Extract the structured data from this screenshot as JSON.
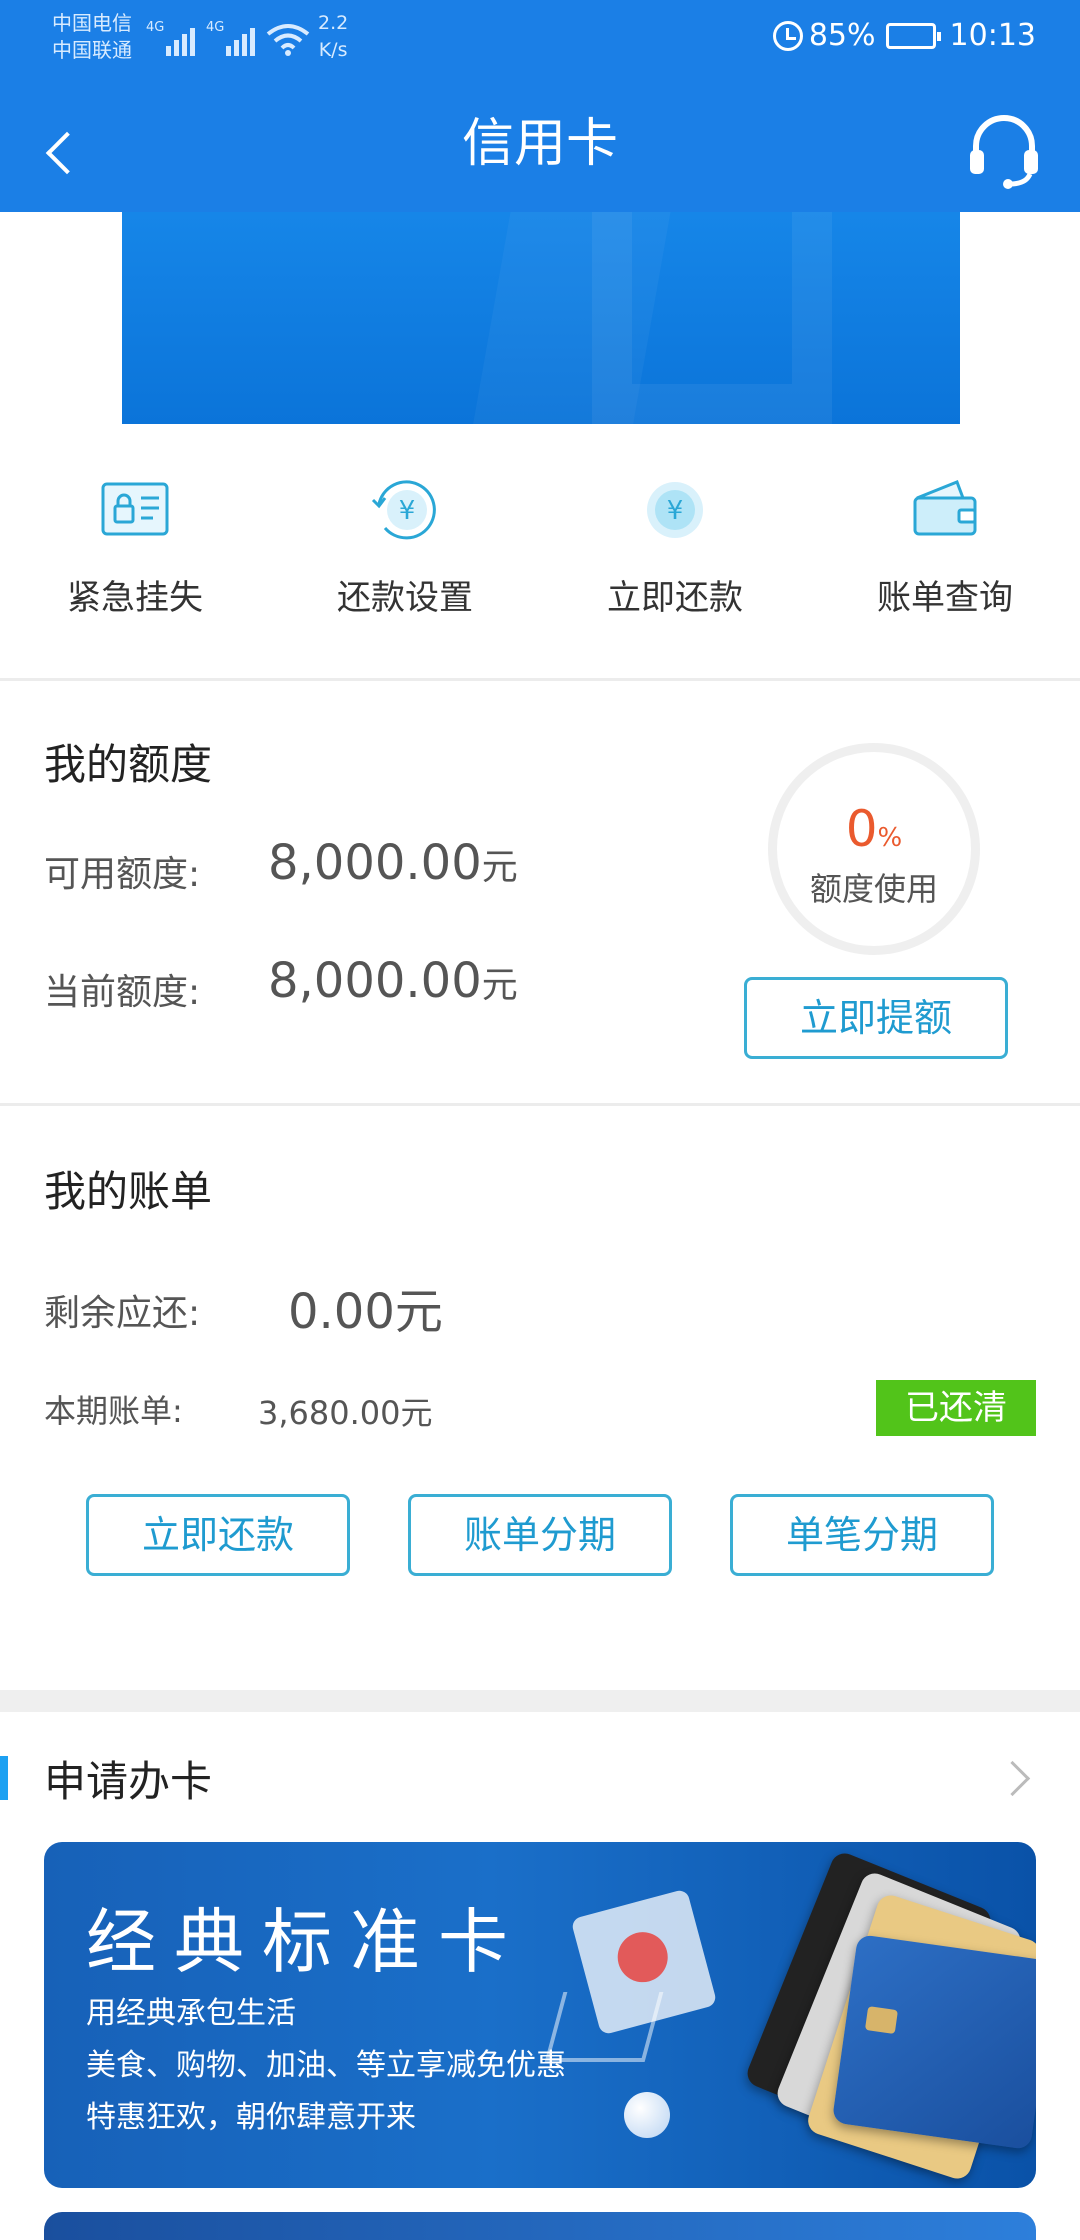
{
  "status_bar": {
    "carrier_1": "中国电信",
    "carrier_2": "中国联通",
    "net_tag": "4G",
    "net_speed_value": "2.2",
    "net_speed_unit": "K/s",
    "battery": "85%",
    "time": "10:13"
  },
  "navbar": {
    "title": "信用卡",
    "back_icon": "chevron-left-icon",
    "service_icon": "headset-icon"
  },
  "quick_actions": [
    {
      "label": "紧急挂失",
      "icon": "card-lock-icon"
    },
    {
      "label": "还款设置",
      "icon": "yuan-refresh-icon"
    },
    {
      "label": "立即还款",
      "icon": "yuan-coin-icon"
    },
    {
      "label": "账单查询",
      "icon": "wallet-icon"
    }
  ],
  "quota": {
    "title": "我的额度",
    "available_label": "可用额度:",
    "available_value": "8,000.00",
    "current_label": "当前额度:",
    "current_value": "8,000.00",
    "currency": "元",
    "usage_percent": "0",
    "usage_percent_sign": "%",
    "usage_label": "额度使用",
    "raise_button": "立即提额"
  },
  "bill": {
    "title": "我的账单",
    "remaining_label": "剩余应还:",
    "remaining_value": "0.00元",
    "period_label": "本期账单:",
    "period_value": "3,680.00元",
    "status_badge": "已还清",
    "buttons": [
      "立即还款",
      "账单分期",
      "单笔分期"
    ]
  },
  "apply": {
    "title": "申请办卡",
    "promo_title": "经典标准卡",
    "promo_lines": [
      "用经典承包生活",
      "美食、购物、加油、等立享减免优惠",
      "特惠狂欢，朝你肆意开来"
    ]
  },
  "colors": {
    "brand_blue": "#1b7fe6",
    "accent_cyan": "#3aaed4",
    "usage_red": "#ea5a2e",
    "paid_green": "#52c41a"
  }
}
